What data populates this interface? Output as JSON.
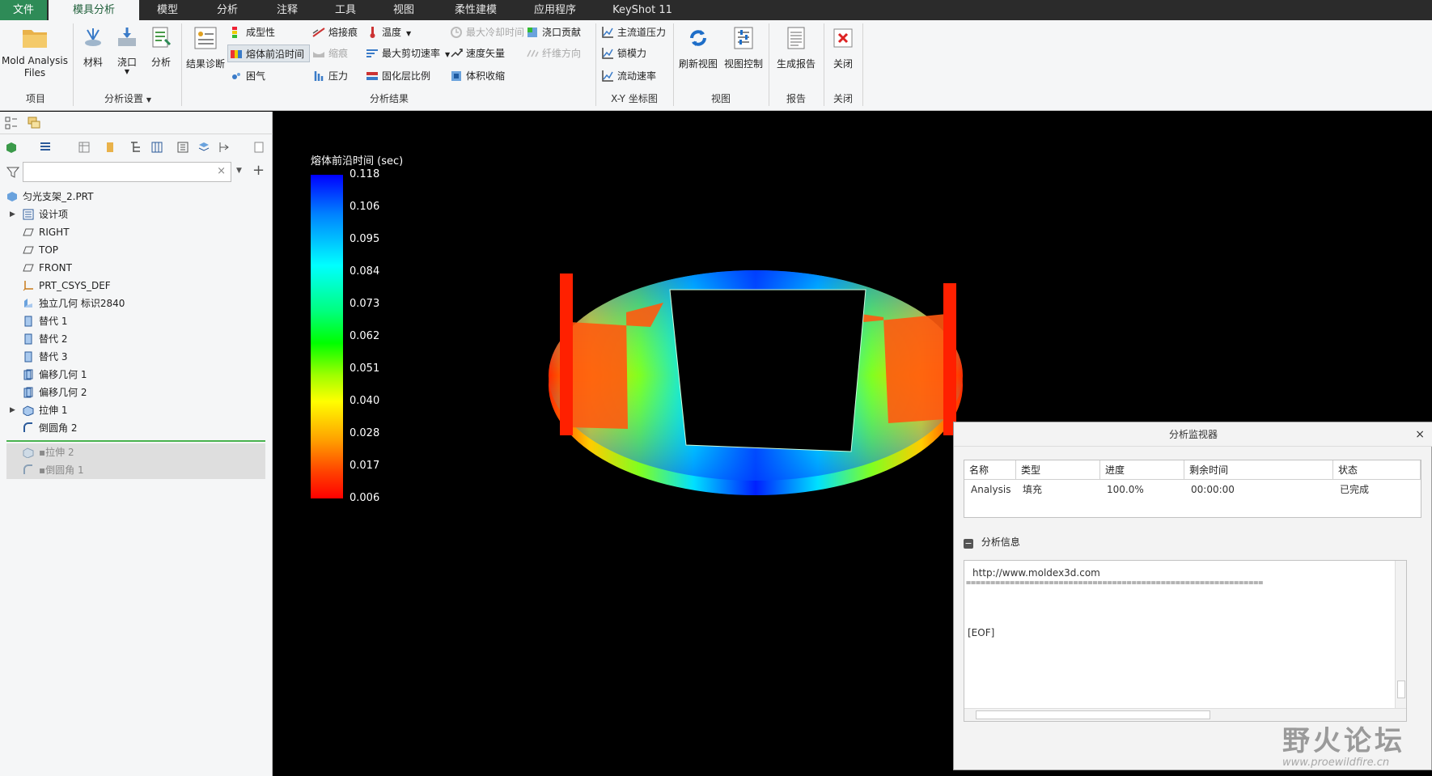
{
  "menubar": {
    "items": [
      "文件",
      "模具分析",
      "模型",
      "分析",
      "注释",
      "工具",
      "视图",
      "柔性建模",
      "应用程序",
      "KeyShot 11"
    ],
    "active": "模具分析"
  },
  "ribbon": {
    "groups": {
      "project": {
        "label": "项目",
        "mold_files": "Mold Analysis\nFiles"
      },
      "settings": {
        "label": "分析设置",
        "material": "材料",
        "gate": "浇口",
        "analysis": "分析"
      },
      "results": {
        "label": "分析结果",
        "diagnosis": "结果诊断",
        "c1": [
          "成型性",
          "熔体前沿时间",
          "困气"
        ],
        "c2": [
          "熔接痕",
          "缩痕",
          "压力"
        ],
        "c3": [
          "温度",
          "最大剪切速率",
          "固化层比例"
        ],
        "c4": [
          "最大冷却时间",
          "速度矢量",
          "体积收缩"
        ],
        "c5": [
          "浇口贡献",
          "纤维方向"
        ]
      },
      "xy": {
        "label": "X-Y 坐标图",
        "items": [
          "主流道压力",
          "锁模力",
          "流动速率"
        ]
      },
      "view": {
        "label": "视图",
        "refresh": "刷新视图",
        "control": "视图控制"
      },
      "report": {
        "label": "报告",
        "generate": "生成报告"
      },
      "close": {
        "label": "关闭",
        "close": "关闭"
      }
    }
  },
  "tree": {
    "root": "匀光支架_2.PRT",
    "items": [
      "设计项",
      "RIGHT",
      "TOP",
      "FRONT",
      "PRT_CSYS_DEF",
      "独立几何 标识2840",
      "替代 1",
      "替代 2",
      "替代 3",
      "偏移几何 1",
      "偏移几何 2",
      "拉伸 1",
      "倒圆角 2"
    ],
    "suppressed": [
      "拉伸 2",
      "倒圆角 1"
    ]
  },
  "legend": {
    "title": "熔体前沿时间 (sec)",
    "ticks": [
      "0.118",
      "0.106",
      "0.095",
      "0.084",
      "0.073",
      "0.062",
      "0.051",
      "0.040",
      "0.028",
      "0.017",
      "0.006"
    ]
  },
  "monitor": {
    "title": "分析监视器",
    "close": "×",
    "columns": [
      "名称",
      "类型",
      "进度",
      "剩余时间",
      "状态"
    ],
    "row": [
      "Analysis",
      "填充",
      "100.0%",
      "00:00:00",
      "已完成"
    ],
    "info_title": "分析信息",
    "info_lines": [
      "http://www.moldex3d.com",
      "=============================================================",
      "[EOF]"
    ]
  },
  "watermark": {
    "brand": "野火论坛",
    "url": "www.proewildfire.cn"
  }
}
